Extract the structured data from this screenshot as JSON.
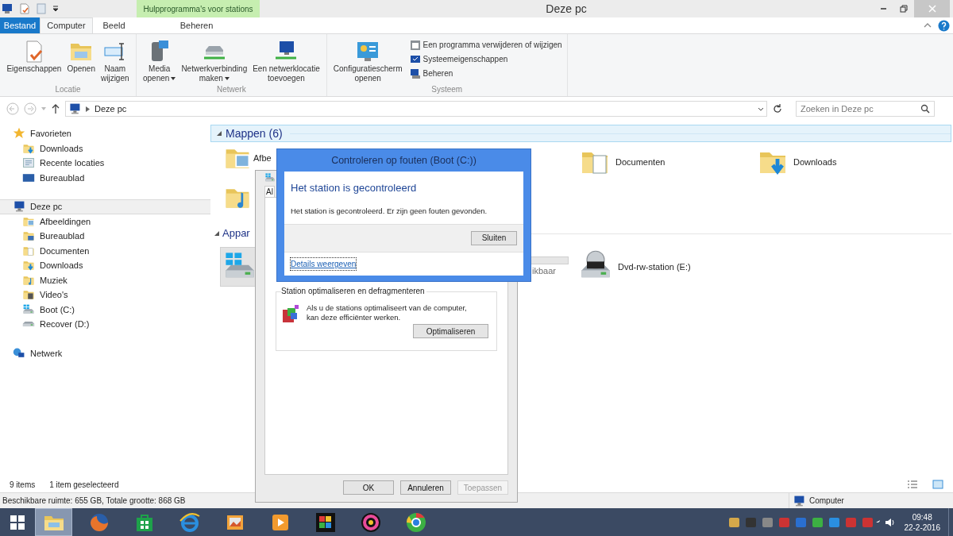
{
  "window": {
    "title": "Deze pc"
  },
  "ribbon": {
    "context_group": "Hulpprogramma's voor stations",
    "tabs": [
      {
        "label": "Bestand",
        "kind": "file",
        "selected": false
      },
      {
        "label": "Computer",
        "kind": "normal",
        "selected": true
      },
      {
        "label": "Beeld",
        "kind": "normal",
        "selected": false
      },
      {
        "label": "Beheren",
        "kind": "context",
        "selected": false
      }
    ],
    "groups": [
      {
        "label": "Locatie",
        "items": [
          {
            "kind": "properties",
            "lines": [
              "Eigenschappen"
            ],
            "dropdown": false
          },
          {
            "kind": "open",
            "lines": [
              "Openen"
            ],
            "dropdown": false
          },
          {
            "kind": "rename",
            "lines": [
              "Naam",
              "wijzigen"
            ],
            "dropdown": false
          }
        ]
      },
      {
        "label": "Netwerk",
        "items": [
          {
            "kind": "media",
            "lines": [
              "Media",
              "openen"
            ],
            "dropdown": true
          },
          {
            "kind": "netdrive",
            "lines": [
              "Netwerkverbinding",
              "maken"
            ],
            "dropdown": true
          },
          {
            "kind": "netlocation",
            "lines": [
              "Een netwerklocatie",
              "toevoegen"
            ],
            "dropdown": false
          }
        ]
      },
      {
        "label": "Systeem",
        "items": [
          {
            "kind": "controlpanel",
            "lines": [
              "Configuratiescherm",
              "openen"
            ],
            "dropdown": false
          }
        ],
        "small_items": [
          {
            "kind": "uninstall",
            "label": "Een programma verwijderen of wijzigen"
          },
          {
            "kind": "sysprops",
            "label": "Systeemeigenschappen"
          },
          {
            "kind": "manage",
            "label": "Beheren"
          }
        ]
      }
    ]
  },
  "address_bar": {
    "path": "Deze pc"
  },
  "search": {
    "placeholder": "Zoeken in Deze pc"
  },
  "navigation": [
    {
      "label": "Favorieten",
      "kind": "star",
      "selected": false,
      "children": [
        {
          "label": "Downloads",
          "kind": "downloads",
          "selected": false
        },
        {
          "label": "Recente locaties",
          "kind": "recent",
          "selected": false
        },
        {
          "label": "Bureaublad",
          "kind": "desktop",
          "selected": false
        }
      ]
    },
    {
      "label": "Deze pc",
      "kind": "pc",
      "selected": true,
      "children": [
        {
          "label": "Afbeeldingen",
          "kind": "pictures",
          "selected": false
        },
        {
          "label": "Bureaublad",
          "kind": "desktopfolder",
          "selected": false
        },
        {
          "label": "Documenten",
          "kind": "documents",
          "selected": false
        },
        {
          "label": "Downloads",
          "kind": "downloads",
          "selected": false
        },
        {
          "label": "Muziek",
          "kind": "music",
          "selected": false
        },
        {
          "label": "Video's",
          "kind": "videos",
          "selected": false
        },
        {
          "label": "Boot (C:)",
          "kind": "windrive",
          "selected": false
        },
        {
          "label": "Recover (D:)",
          "kind": "drive",
          "selected": false
        }
      ]
    },
    {
      "label": "Netwerk",
      "kind": "network",
      "selected": false
    }
  ],
  "folders": {
    "title": "Mappen (6)",
    "selected": true,
    "items": [
      {
        "kind": "pictures",
        "label": "Afbe"
      },
      {
        "kind": "music"
      },
      {
        "kind": "documents",
        "label": "Documenten"
      },
      {
        "kind": "downloads",
        "label": "Downloads"
      }
    ]
  },
  "devices": {
    "title": "Appar",
    "selected": false,
    "items": [
      {
        "kind": "windrive",
        "selected": true
      },
      {
        "kind": "drive",
        "detail": "ikbaar",
        "selected": false
      },
      {
        "kind": "dvd",
        "label": "Dvd-rw-station (E:)",
        "selected": false
      }
    ]
  },
  "status_bar": {
    "count": "9 items",
    "selection": "1 item geselecteerd"
  },
  "details_bar": {
    "text": "Beschikbare ruimte: 655 GB, Totale grootte: 868 GB",
    "location": "Computer"
  },
  "properties_dialog": {
    "tab": "Al",
    "group_title": "Station optimaliseren en defragmenteren",
    "text": "Als u de stations optimaliseert van de computer, kan deze efficiënter werken.",
    "action": "Optimaliseren",
    "buttons": [
      {
        "label": "OK",
        "disabled": false
      },
      {
        "label": "Annuleren",
        "disabled": false
      },
      {
        "label": "Toepassen",
        "disabled": true
      }
    ]
  },
  "check_dialog": {
    "title": "Controleren op fouten (Boot (C:))",
    "heading": "Het station is gecontroleerd",
    "message": "Het station is gecontroleerd. Er zijn geen fouten gevonden.",
    "button": "Sluiten",
    "link": "Details weergeven"
  },
  "taskbar": {
    "apps": [
      {
        "kind": "explorer",
        "selected": true
      },
      {
        "kind": "firefox",
        "selected": false
      },
      {
        "kind": "store",
        "selected": false
      },
      {
        "kind": "ie",
        "selected": false
      },
      {
        "kind": "photos",
        "selected": false
      },
      {
        "kind": "player",
        "selected": false
      },
      {
        "kind": "puzzle",
        "selected": false
      },
      {
        "kind": "disc",
        "selected": false
      },
      {
        "kind": "chrome",
        "selected": false
      }
    ],
    "time": "09:48",
    "date": "22-2-2016"
  }
}
